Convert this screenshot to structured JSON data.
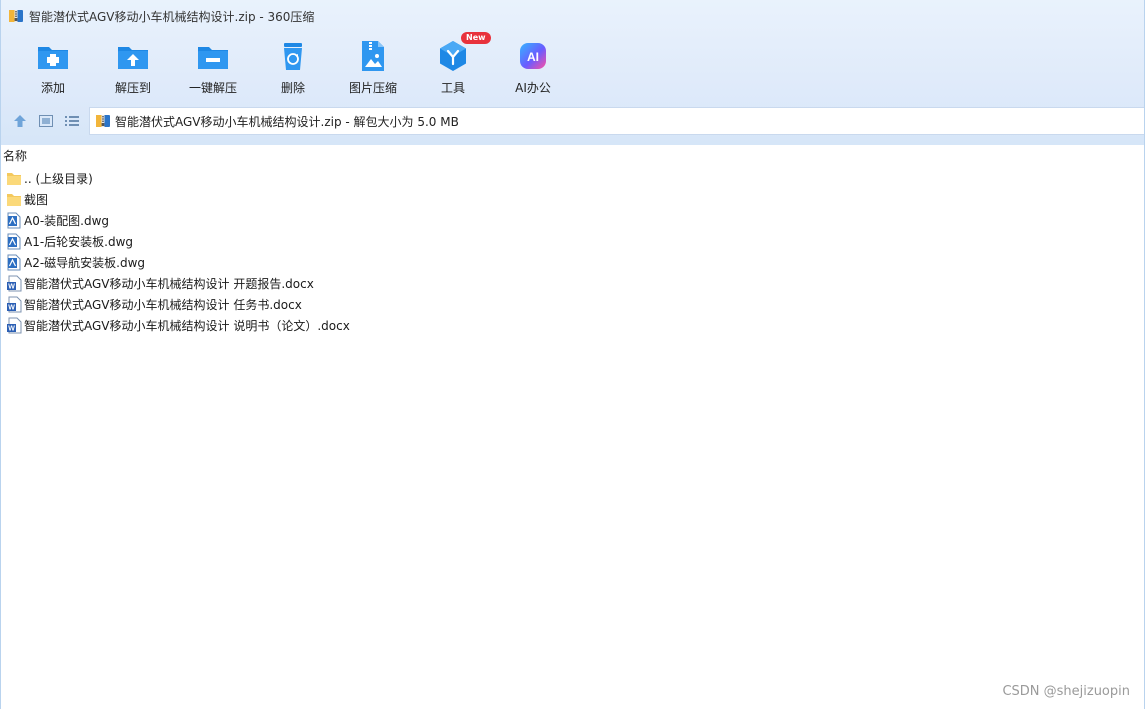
{
  "window": {
    "title": "智能潜伏式AGV移动小车机械结构设计.zip - 360压缩"
  },
  "toolbar": {
    "items": [
      {
        "label": "添加",
        "icon": "folder-add-icon"
      },
      {
        "label": "解压到",
        "icon": "folder-extract-icon"
      },
      {
        "label": "一键解压",
        "icon": "folder-quick-extract-icon"
      },
      {
        "label": "删除",
        "icon": "recycle-bin-icon"
      },
      {
        "label": "图片压缩",
        "icon": "image-compress-icon"
      },
      {
        "label": "工具",
        "icon": "tools-cube-icon",
        "badge": "New"
      },
      {
        "label": "AI办公",
        "icon": "ai-office-icon"
      }
    ]
  },
  "address": {
    "text": "智能潜伏式AGV移动小车机械结构设计.zip - 解包大小为 5.0 MB"
  },
  "list": {
    "column_name": "名称",
    "items": [
      {
        "name": ".. (上级目录)",
        "type": "folder"
      },
      {
        "name": "截图",
        "type": "folder"
      },
      {
        "name": "A0-装配图.dwg",
        "type": "dwg"
      },
      {
        "name": "A1-后轮安装板.dwg",
        "type": "dwg"
      },
      {
        "name": "A2-磁导航安装板.dwg",
        "type": "dwg"
      },
      {
        "name": "智能潜伏式AGV移动小车机械结构设计 开题报告.docx",
        "type": "docx"
      },
      {
        "name": "智能潜伏式AGV移动小车机械结构设计 任务书.docx",
        "type": "docx"
      },
      {
        "name": "智能潜伏式AGV移动小车机械结构设计 说明书（论文）.docx",
        "type": "docx"
      }
    ]
  },
  "watermark": "CSDN @shejizuopin",
  "colors": {
    "accent_blue": "#1e88e5",
    "chrome_bg": "#dfeafa",
    "badge_red": "#e8323c"
  }
}
